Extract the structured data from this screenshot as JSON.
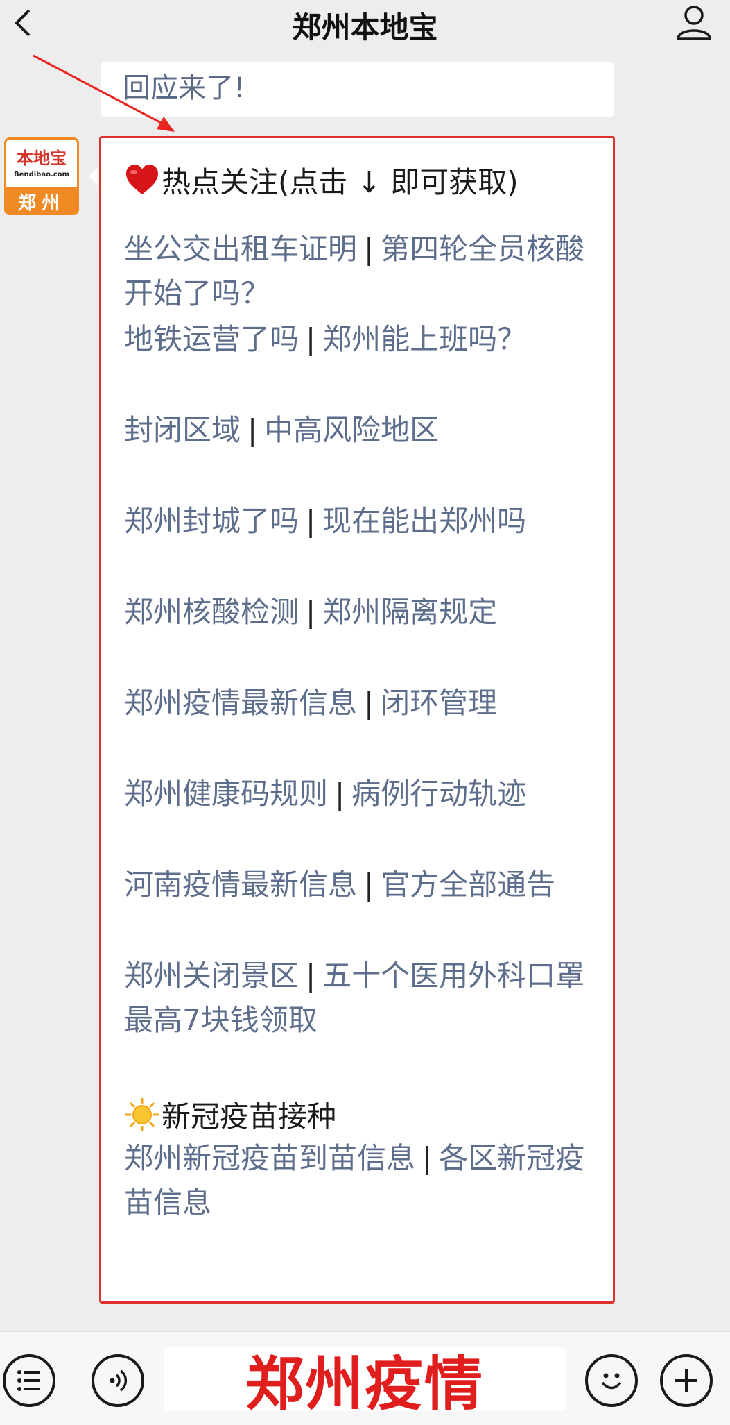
{
  "header": {
    "title": "郑州本地宝",
    "back_icon": "chevron-left-icon",
    "profile_icon": "person-icon"
  },
  "previous_message": {
    "text": "回应来了!"
  },
  "avatar": {
    "brand": "本地宝",
    "url": "Bendibao.com",
    "city": "郑州"
  },
  "message": {
    "heading_icon": "heart-icon",
    "heading": "热点关注(点击 ↓ 即可获取)",
    "links": [
      {
        "left": "坐公交出租车证明",
        "right": "第四轮全员核酸开始了吗？"
      },
      {
        "left": "地铁运营了吗",
        "right": "郑州能上班吗？"
      },
      {
        "left": "封闭区域",
        "right": "中高风险地区"
      },
      {
        "left": "郑州封城了吗",
        "right": "现在能出郑州吗"
      },
      {
        "left": "郑州核酸检测",
        "right": "郑州隔离规定"
      },
      {
        "left": "郑州疫情最新信息",
        "right": "闭环管理"
      },
      {
        "left": "郑州健康码规则",
        "right": "病例行动轨迹"
      },
      {
        "left": "河南疫情最新信息",
        "right": "官方全部通告"
      },
      {
        "left": "郑州关闭景区",
        "right": "五十个医用外科口罩最高7块钱领取"
      }
    ],
    "vaccine_icon": "sun-icon",
    "vaccine_heading": "新冠疫苗接种",
    "vaccine_link": {
      "left": "郑州新冠疫苗到苗信息",
      "right": "各区新冠疫苗信息"
    },
    "separator": "|"
  },
  "input": {
    "text": "郑州疫情",
    "menu_icon": "list-menu-icon",
    "voice_icon": "voice-icon",
    "emoji_icon": "smiley-icon",
    "add_icon": "plus-icon"
  },
  "colors": {
    "link": "#5d6d8c",
    "border": "#e0322c",
    "overlay_text": "#e01e1e",
    "brand_orange": "#f08a24"
  }
}
